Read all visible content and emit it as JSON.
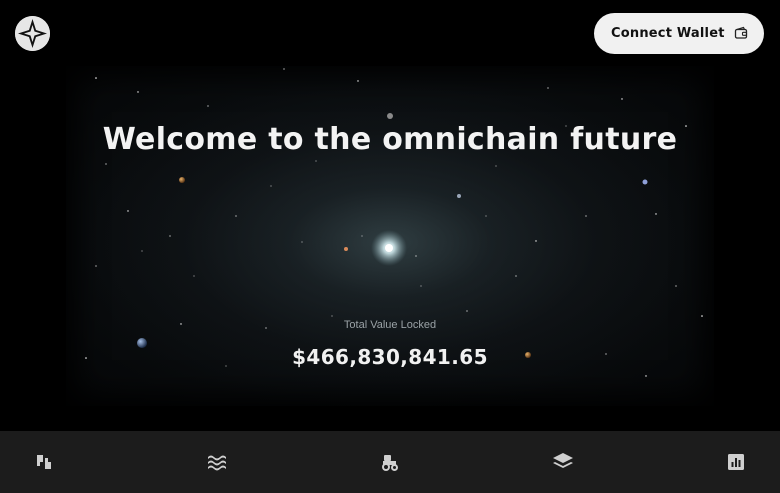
{
  "header": {
    "logo_icon": "omnichain-logo-icon",
    "connect_wallet_label": "Connect Wallet",
    "wallet_icon": "wallet-icon"
  },
  "hero": {
    "title": "Welcome to the omnichain future",
    "tvl_label": "Total Value Locked",
    "tvl_value": "$466,830,841.65"
  },
  "bottom_nav": {
    "items": [
      {
        "icon": "swap-icon"
      },
      {
        "icon": "pools-icon"
      },
      {
        "icon": "farm-icon"
      },
      {
        "icon": "stake-icon"
      },
      {
        "icon": "analytics-icon"
      }
    ]
  },
  "colors": {
    "background": "#000000",
    "button_bg": "#f1f1f1",
    "nav_bg": "#1c1c1c",
    "text_primary": "#f3f3f3",
    "text_muted": "#9aa2a6"
  }
}
